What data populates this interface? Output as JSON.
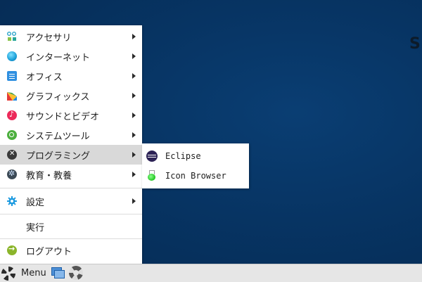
{
  "menu": {
    "items": [
      {
        "label": "アクセサリ",
        "icon": "accessories-icon",
        "submenu": true
      },
      {
        "label": "インターネット",
        "icon": "internet-icon",
        "submenu": true
      },
      {
        "label": "オフィス",
        "icon": "office-icon",
        "submenu": true
      },
      {
        "label": "グラフィックス",
        "icon": "graphics-icon",
        "submenu": true
      },
      {
        "label": "サウンドとビデオ",
        "icon": "sound-video-icon",
        "submenu": true
      },
      {
        "label": "システムツール",
        "icon": "system-tools-icon",
        "submenu": true
      },
      {
        "label": "プログラミング",
        "icon": "programming-icon",
        "submenu": true,
        "active": true
      },
      {
        "label": "教育・教養",
        "icon": "education-icon",
        "submenu": true
      },
      {
        "label": "設定",
        "icon": "settings-gear-icon",
        "submenu": true
      },
      {
        "label": "実行",
        "icon": "",
        "submenu": false
      },
      {
        "label": "ログアウト",
        "icon": "logout-icon",
        "submenu": false
      }
    ]
  },
  "submenu": {
    "items": [
      {
        "label": "Eclipse",
        "icon": "eclipse-icon"
      },
      {
        "label": "Icon Browser",
        "icon": "icon-browser-icon"
      }
    ]
  },
  "taskbar": {
    "menu_label": "Menu"
  },
  "colors": {
    "desktop": "#073463",
    "menu_bg": "#ffffff",
    "active_bg": "#d9d9d9",
    "taskbar_bg": "#e6e6e6"
  }
}
